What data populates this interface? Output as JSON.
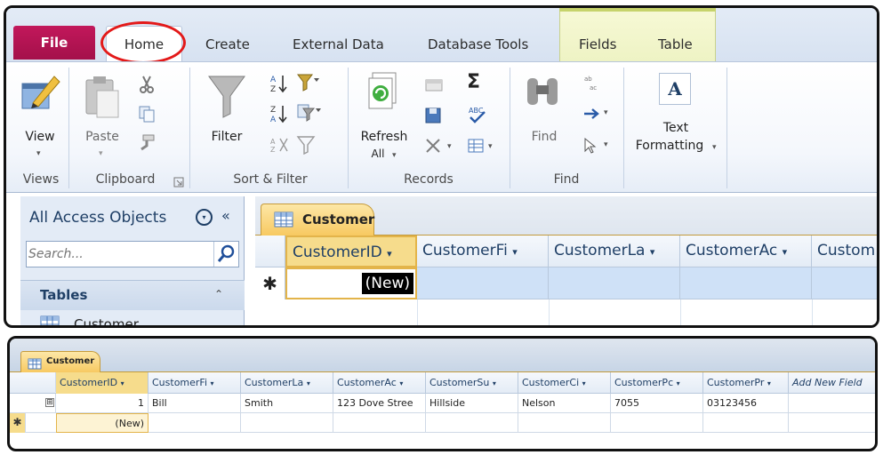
{
  "ribbon": {
    "tabs": {
      "file": "File",
      "home": "Home",
      "create": "Create",
      "external_data": "External Data",
      "database_tools": "Database Tools",
      "fields": "Fields",
      "table": "Table"
    },
    "buttons": {
      "view": "View",
      "paste": "Paste",
      "filter": "Filter",
      "refresh": "Refresh",
      "refresh_sub": "All",
      "find": "Find",
      "text_formatting_1": "Text",
      "text_formatting_2": "Formatting"
    },
    "groups": {
      "views": "Views",
      "clipboard": "Clipboard",
      "sort_filter": "Sort & Filter",
      "records": "Records",
      "find": "Find"
    }
  },
  "nav_pane": {
    "title": "All Access Objects",
    "collapse": "«",
    "search_placeholder": "Search...",
    "section": "Tables",
    "items": [
      "Customer"
    ]
  },
  "top_datasheet": {
    "tab": "Customer",
    "columns": [
      "CustomerID",
      "CustomerFi",
      "CustomerLa",
      "CustomerAc",
      "Custom"
    ],
    "new_row_marker": "✱",
    "new_label": "(New)"
  },
  "bottom_datasheet": {
    "tab": "Customer",
    "columns": [
      "CustomerID",
      "CustomerFi",
      "CustomerLa",
      "CustomerAc",
      "CustomerSu",
      "CustomerCi",
      "CustomerPc",
      "CustomerPr",
      "Add New Field"
    ],
    "rows": [
      [
        "1",
        "Bill",
        "Smith",
        "123 Dove Stree",
        "Hillside",
        "Nelson",
        "7055",
        "03123456",
        ""
      ]
    ],
    "new_row_marker": "✱",
    "new_label": "(New)",
    "expand_glyph": "⊞"
  },
  "icons": {
    "dropdown": "▾",
    "sort_asc": "A↓Z",
    "sigma": "Σ",
    "text_a": "A",
    "chevron": "⌃"
  },
  "colors": {
    "file_tab": "#b0134f",
    "highlight_ring": "#e31919",
    "doc_tab": "#f7c85f"
  }
}
